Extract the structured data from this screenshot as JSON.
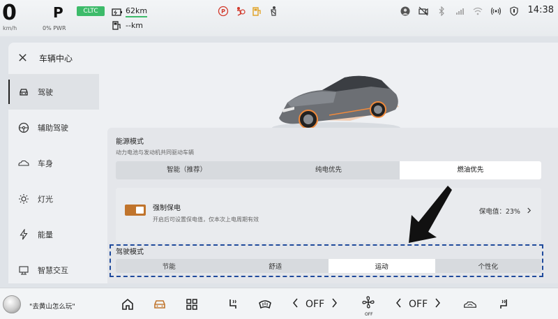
{
  "status": {
    "speed": "0",
    "speed_unit": "km/h",
    "gear": "P",
    "power": "0% PWR",
    "range_badge": "CLTC",
    "battery_range": "62km",
    "fuel_range": "--km",
    "time": "14:38"
  },
  "panel": {
    "title": "车辆中心",
    "sidebar": [
      {
        "label": "驾驶",
        "icon": "car-front-icon",
        "active": true
      },
      {
        "label": "辅助驾驶",
        "icon": "steering-wheel-icon",
        "active": false
      },
      {
        "label": "车身",
        "icon": "car-body-icon",
        "active": false
      },
      {
        "label": "灯光",
        "icon": "light-icon",
        "active": false
      },
      {
        "label": "能量",
        "icon": "lightning-icon",
        "active": false
      },
      {
        "label": "智慧交互",
        "icon": "interaction-icon",
        "active": false
      }
    ],
    "energy_mode": {
      "title": "能源模式",
      "desc": "动力电池与发动机共同驱动车辆",
      "options": [
        "智能（推荐）",
        "纯电优先",
        "燃油优先"
      ],
      "selected": "燃油优先"
    },
    "forced_save": {
      "label": "强制保电",
      "desc": "开启后可设置保电值，仅本次上电周期有效",
      "value": "保电值：23%",
      "enabled": true
    },
    "drive_mode": {
      "title": "驾驶模式",
      "options": [
        "节能",
        "舒适",
        "运动",
        "个性化"
      ],
      "selected": "运动"
    }
  },
  "dock": {
    "assistant_text": "\"去黄山怎么玩\"",
    "left_temp": "OFF",
    "fan": "OFF",
    "right_temp": "OFF"
  },
  "colors": {
    "accent_orange": "#c0742c",
    "cltc_green": "#3dbb6a",
    "highlight_blue": "#1f4a9c"
  }
}
